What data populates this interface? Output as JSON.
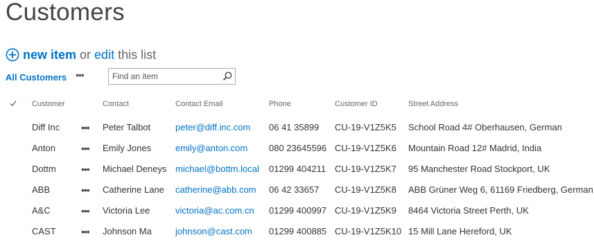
{
  "page": {
    "title": "Customers"
  },
  "actions": {
    "new_item": "new item",
    "or": "or",
    "edit": "edit",
    "this_list": "this list"
  },
  "view": {
    "current": "All Customers",
    "more": "•••",
    "search_placeholder": "Find an item"
  },
  "table": {
    "headers": {
      "customer": "Customer",
      "contact": "Contact",
      "email": "Contact Email",
      "phone": "Phone",
      "id": "Customer ID",
      "street": "Street Address"
    },
    "row_menu": "•••",
    "rows": [
      {
        "customer": "Diff Inc",
        "contact": "Peter Talbot",
        "email": "peter@diff.inc.com",
        "phone": "06 41 35899",
        "id": "CU-19-V1Z5K5",
        "street": "School Road 4# Oberhausen, German"
      },
      {
        "customer": "Anton",
        "contact": "Emily Jones",
        "email": "emily@anton.com",
        "phone": "080 23645596",
        "id": "CU-19-V1Z5K6",
        "street": "Mountain Road 12# Madrid, India"
      },
      {
        "customer": "Dottm",
        "contact": "Michael Deneys",
        "email": "michael@bottm.local",
        "phone": "01299 404211",
        "id": "CU-19-V1Z5K7",
        "street": "95 Manchester Road Stockport, UK"
      },
      {
        "customer": "ABB",
        "contact": "Catherine Lane",
        "email": "catherine@abb.com",
        "phone": "06 42 33657",
        "id": "CU-19-V1Z5K8",
        "street": "ABB Grüner Weg 6, 61169 Friedberg, German"
      },
      {
        "customer": "A&C",
        "contact": "Victoria Lee",
        "email": "victoria@ac.com.cn",
        "phone": "01299 400997",
        "id": "CU-19-V1Z5K9",
        "street": "8464 Victoria Street Perth, UK"
      },
      {
        "customer": "CAST",
        "contact": "Johnson Ma",
        "email": "johnson@cast.com",
        "phone": "01299 400885",
        "id": "CU-19-V1Z5K10",
        "street": "15 Mill Lane Hereford, UK"
      }
    ]
  },
  "icons": {
    "new_item": "plus-circle-icon",
    "search": "search-icon",
    "select_all": "checkmark-icon"
  },
  "colors": {
    "link": "#0072c6",
    "title": "#444444",
    "header_text": "#666666"
  }
}
